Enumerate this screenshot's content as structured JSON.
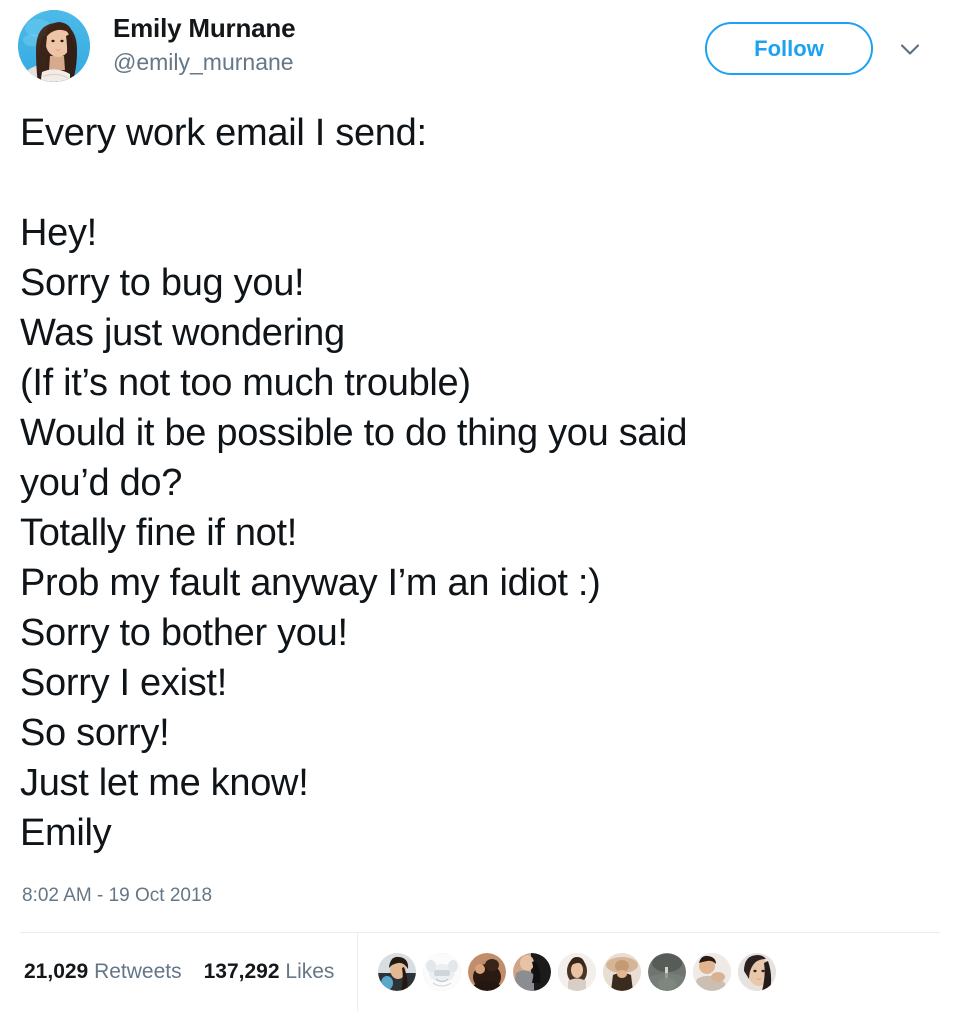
{
  "account": {
    "display_name": "Emily Murnane",
    "handle": "@emily_murnane",
    "avatar_icon": "user-avatar-photo"
  },
  "actions": {
    "follow_label": "Follow",
    "caret_icon": "chevron-down-icon"
  },
  "tweet": {
    "lines": [
      "Every work email I send:",
      "",
      "Hey!",
      "Sorry to bug you!",
      "Was just wondering",
      "(If it’s not too much trouble)",
      "Would it be possible to do thing you said",
      "you’d do?",
      "Totally fine if not!",
      "Prob my fault anyway I’m an idiot :)",
      "Sorry to bother you!",
      "Sorry I exist!",
      "So sorry!",
      "Just let me know!",
      "Emily"
    ],
    "timestamp": "8:02 AM - 19 Oct 2018"
  },
  "stats": {
    "retweets_count": "21,029",
    "retweets_label": "Retweets",
    "likes_count": "137,292",
    "likes_label": "Likes"
  },
  "liker_faces": [
    {
      "name": "liker-avatar-1"
    },
    {
      "name": "liker-avatar-2"
    },
    {
      "name": "liker-avatar-3"
    },
    {
      "name": "liker-avatar-4"
    },
    {
      "name": "liker-avatar-5"
    },
    {
      "name": "liker-avatar-6"
    },
    {
      "name": "liker-avatar-7"
    },
    {
      "name": "liker-avatar-8"
    },
    {
      "name": "liker-avatar-9"
    }
  ],
  "colors": {
    "brand_blue": "#1da1f2",
    "text_primary": "#0f1419",
    "text_muted": "#657786",
    "divider": "#e6ecf0"
  }
}
